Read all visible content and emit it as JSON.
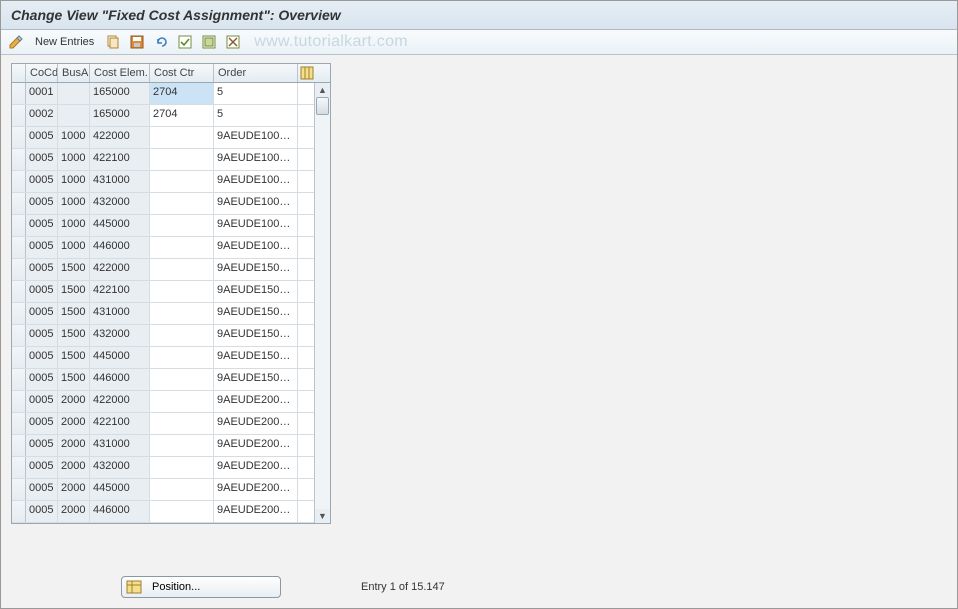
{
  "title": "Change View \"Fixed Cost Assignment\": Overview",
  "toolbar": {
    "new_entries": "New Entries",
    "watermark": "www.tutorialkart.com"
  },
  "columns": {
    "cocd": "CoCd",
    "busa": "BusA",
    "cele": "Cost Elem.",
    "cctr": "Cost Ctr",
    "order": "Order"
  },
  "rows": [
    {
      "cocd": "0001",
      "busa": "",
      "cele": "165000",
      "cctr": "2704",
      "order": "5",
      "ctr_selected": true
    },
    {
      "cocd": "0002",
      "busa": "",
      "cele": "165000",
      "cctr": "2704",
      "order": "5"
    },
    {
      "cocd": "0005",
      "busa": "1000",
      "cele": "422000",
      "cctr": "",
      "order": "9AEUDE100…"
    },
    {
      "cocd": "0005",
      "busa": "1000",
      "cele": "422100",
      "cctr": "",
      "order": "9AEUDE100…"
    },
    {
      "cocd": "0005",
      "busa": "1000",
      "cele": "431000",
      "cctr": "",
      "order": "9AEUDE100…"
    },
    {
      "cocd": "0005",
      "busa": "1000",
      "cele": "432000",
      "cctr": "",
      "order": "9AEUDE100…"
    },
    {
      "cocd": "0005",
      "busa": "1000",
      "cele": "445000",
      "cctr": "",
      "order": "9AEUDE100…"
    },
    {
      "cocd": "0005",
      "busa": "1000",
      "cele": "446000",
      "cctr": "",
      "order": "9AEUDE100…"
    },
    {
      "cocd": "0005",
      "busa": "1500",
      "cele": "422000",
      "cctr": "",
      "order": "9AEUDE150…"
    },
    {
      "cocd": "0005",
      "busa": "1500",
      "cele": "422100",
      "cctr": "",
      "order": "9AEUDE150…"
    },
    {
      "cocd": "0005",
      "busa": "1500",
      "cele": "431000",
      "cctr": "",
      "order": "9AEUDE150…"
    },
    {
      "cocd": "0005",
      "busa": "1500",
      "cele": "432000",
      "cctr": "",
      "order": "9AEUDE150…"
    },
    {
      "cocd": "0005",
      "busa": "1500",
      "cele": "445000",
      "cctr": "",
      "order": "9AEUDE150…"
    },
    {
      "cocd": "0005",
      "busa": "1500",
      "cele": "446000",
      "cctr": "",
      "order": "9AEUDE150…"
    },
    {
      "cocd": "0005",
      "busa": "2000",
      "cele": "422000",
      "cctr": "",
      "order": "9AEUDE200…"
    },
    {
      "cocd": "0005",
      "busa": "2000",
      "cele": "422100",
      "cctr": "",
      "order": "9AEUDE200…"
    },
    {
      "cocd": "0005",
      "busa": "2000",
      "cele": "431000",
      "cctr": "",
      "order": "9AEUDE200…"
    },
    {
      "cocd": "0005",
      "busa": "2000",
      "cele": "432000",
      "cctr": "",
      "order": "9AEUDE200…"
    },
    {
      "cocd": "0005",
      "busa": "2000",
      "cele": "445000",
      "cctr": "",
      "order": "9AEUDE200…"
    },
    {
      "cocd": "0005",
      "busa": "2000",
      "cele": "446000",
      "cctr": "",
      "order": "9AEUDE200…"
    }
  ],
  "footer": {
    "position_label": "Position...",
    "entry_text": "Entry 1 of 15.147"
  }
}
